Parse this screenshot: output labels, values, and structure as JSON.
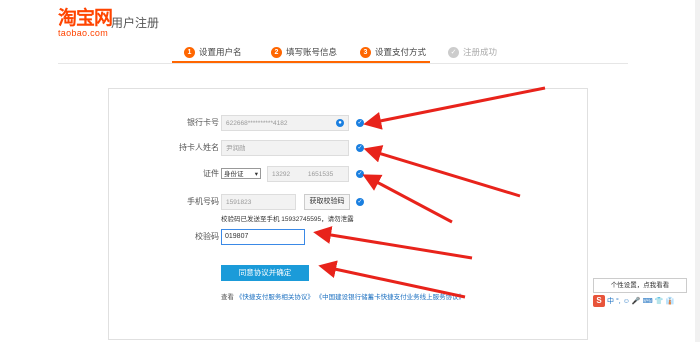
{
  "header": {
    "logo_main": "淘宝网",
    "logo_sub": "taobao.com",
    "page_title": "用户注册"
  },
  "steps": [
    {
      "num": "1",
      "label": "设置用户名",
      "state": "done"
    },
    {
      "num": "2",
      "label": "填写账号信息",
      "state": "done"
    },
    {
      "num": "3",
      "label": "设置支付方式",
      "state": "active"
    },
    {
      "num": "✓",
      "label": "注册成功",
      "state": "pending"
    }
  ],
  "form": {
    "bank_card": {
      "label": "银行卡号",
      "value": "622668**********4182"
    },
    "card_holder": {
      "label": "持卡人姓名",
      "value": "尹润勋"
    },
    "id": {
      "label": "证件",
      "type": "身份证",
      "value_a": "13292",
      "value_b": "1651535"
    },
    "phone": {
      "label": "手机号码",
      "value": "1591823",
      "send_button": "获取校验码"
    },
    "sent_hint": "校验码已发送至手机 15932745595，请勿泄露",
    "code": {
      "label": "校验码",
      "value": "019807"
    },
    "submit": "同意协议并确定",
    "agree_prefix": "查看",
    "agree_link1": "《快捷支付服务相关协议》",
    "agree_link2": "《中国建设银行储蓄卡快捷支付业务线上服务协议》"
  },
  "ime": {
    "tooltip": "个性设置，点我看看",
    "items": [
      "中",
      "°,",
      "☺",
      "🎤",
      "⌨",
      "👕",
      "👔"
    ]
  },
  "colors": {
    "brand": "#ff4400",
    "step_active": "#ff6600",
    "check": "#1a7fe0",
    "submit": "#1b9bd9",
    "arrow": "#e8231b"
  }
}
